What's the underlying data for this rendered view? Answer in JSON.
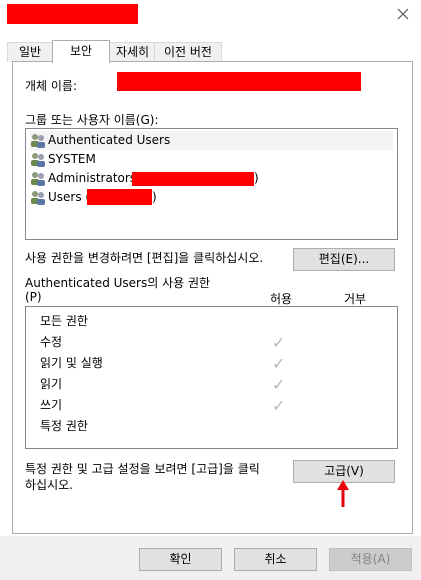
{
  "tabs": [
    {
      "label": "일반"
    },
    {
      "label": "보안"
    },
    {
      "label": "자세히"
    },
    {
      "label": "이전 버전"
    }
  ],
  "object_name_label": "개체 이름:",
  "groups_label": "그룹 또는 사용자 이름(G):",
  "users": [
    {
      "label": "Authenticated Users"
    },
    {
      "label": "SYSTEM"
    },
    {
      "label": "Administrators (",
      "suffix": ")"
    },
    {
      "label": "Users (",
      "suffix": ")"
    }
  ],
  "edit_hint": "사용 권한을 변경하려면 [편집]을 클릭하십시오.",
  "edit_button": "편집(E)...",
  "perm_for_label": "Authenticated Users의 사용 권한",
  "perm_for_accel": "(P)",
  "allow_header": "허용",
  "deny_header": "거부",
  "permissions": [
    {
      "name": "모든 권한",
      "allow": false
    },
    {
      "name": "수정",
      "allow": true
    },
    {
      "name": "읽기 및 실행",
      "allow": true
    },
    {
      "name": "읽기",
      "allow": true
    },
    {
      "name": "쓰기",
      "allow": true
    },
    {
      "name": "특정 권한",
      "allow": false
    }
  ],
  "advanced_hint_line1": "특정 권한 및 고급 설정을 보려면 [고급]을 클릭",
  "advanced_hint_line2": "하십시오.",
  "advanced_button": "고급(V)",
  "ok_button": "확인",
  "cancel_button": "취소",
  "apply_button": "적용(A)",
  "colors": {
    "redaction": "#ff0000",
    "arrow": "#e8000b",
    "check": "#b8b8b8"
  },
  "icons": {
    "close": "close-icon",
    "user_group": "user-group-icon",
    "check": "check-icon"
  }
}
